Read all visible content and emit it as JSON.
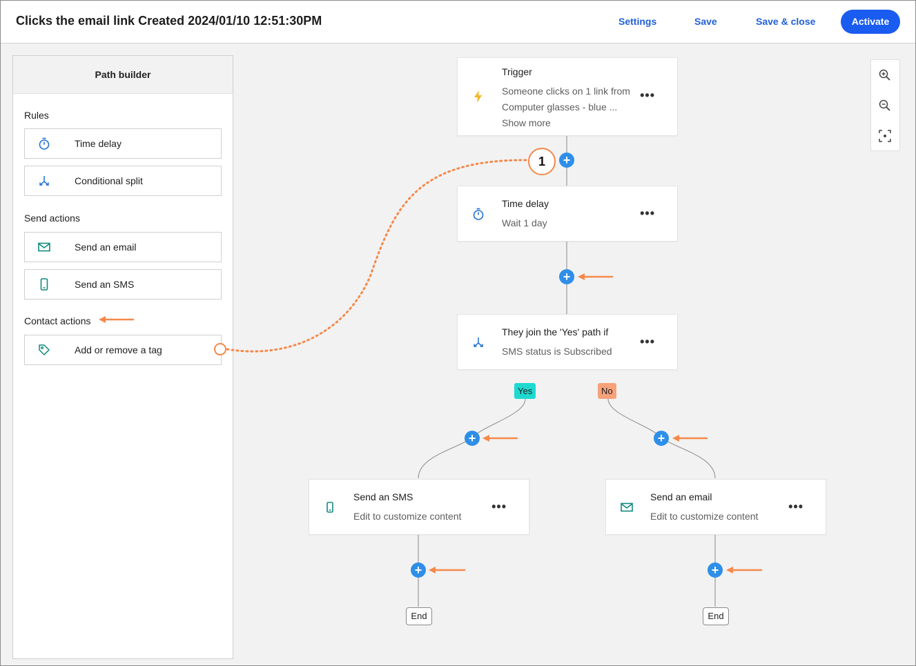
{
  "header": {
    "title": "Clicks the email link Created 2024/01/10 12:51:30PM",
    "settings": "Settings",
    "save": "Save",
    "save_close": "Save & close",
    "activate": "Activate"
  },
  "panel": {
    "title": "Path builder",
    "sections": {
      "rules": "Rules",
      "send_actions": "Send actions",
      "contact_actions": "Contact actions"
    },
    "tools": {
      "time_delay": "Time delay",
      "conditional_split": "Conditional split",
      "send_email": "Send an email",
      "send_sms": "Send an SMS",
      "add_remove_tag": "Add or remove a tag"
    }
  },
  "flow": {
    "trigger": {
      "title": "Trigger",
      "line1": "Someone clicks on 1 link from",
      "line2": "Computer glasses - blue ...",
      "show_more": "Show more"
    },
    "time_delay": {
      "title": "Time delay",
      "subtitle": "Wait 1 day"
    },
    "split": {
      "title": "They join the 'Yes' path if",
      "subtitle": "SMS status is Subscribed"
    },
    "yes_label": "Yes",
    "no_label": "No",
    "sms_card": {
      "title": "Send an SMS",
      "subtitle": "Edit to customize content"
    },
    "email_card": {
      "title": "Send an email",
      "subtitle": "Edit to customize content"
    },
    "end_label": "End",
    "more": "•••",
    "plus": "+"
  },
  "callout_number": "1",
  "colors": {
    "accent": "#1a5cf0",
    "plus": "#2f8fe8",
    "annotation": "#f6884a",
    "yes": "#1ed9d0",
    "no": "#f7a27a",
    "teal_icon": "#0f8a7e",
    "trigger_icon": "#f5b323"
  },
  "icons": [
    "zoom-in-icon",
    "zoom-out-icon",
    "fit-screen-icon",
    "timer-icon",
    "split-icon",
    "mail-icon",
    "phone-icon",
    "tag-icon",
    "lightning-icon",
    "more-icon",
    "plus-icon"
  ]
}
